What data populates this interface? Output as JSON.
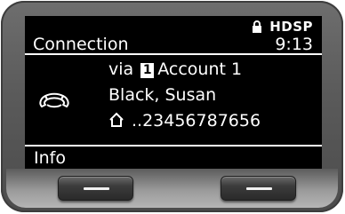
{
  "header": {
    "title": "Connection",
    "time": "9:13",
    "logo_text": "HDSP"
  },
  "call": {
    "via_prefix": "via",
    "account_number": "1",
    "account_name": "Account 1",
    "contact_name": "Black, Susan",
    "number": "..23456787656"
  },
  "footer": {
    "left_softkey_label": "Info"
  },
  "icons": {
    "lock": "lock-icon",
    "handset": "handset-connection-icon",
    "home": "home-icon"
  },
  "colors": {
    "screen_background": "#000000",
    "screen_text": "#ffffff",
    "bezel": "#5a5a5a"
  }
}
